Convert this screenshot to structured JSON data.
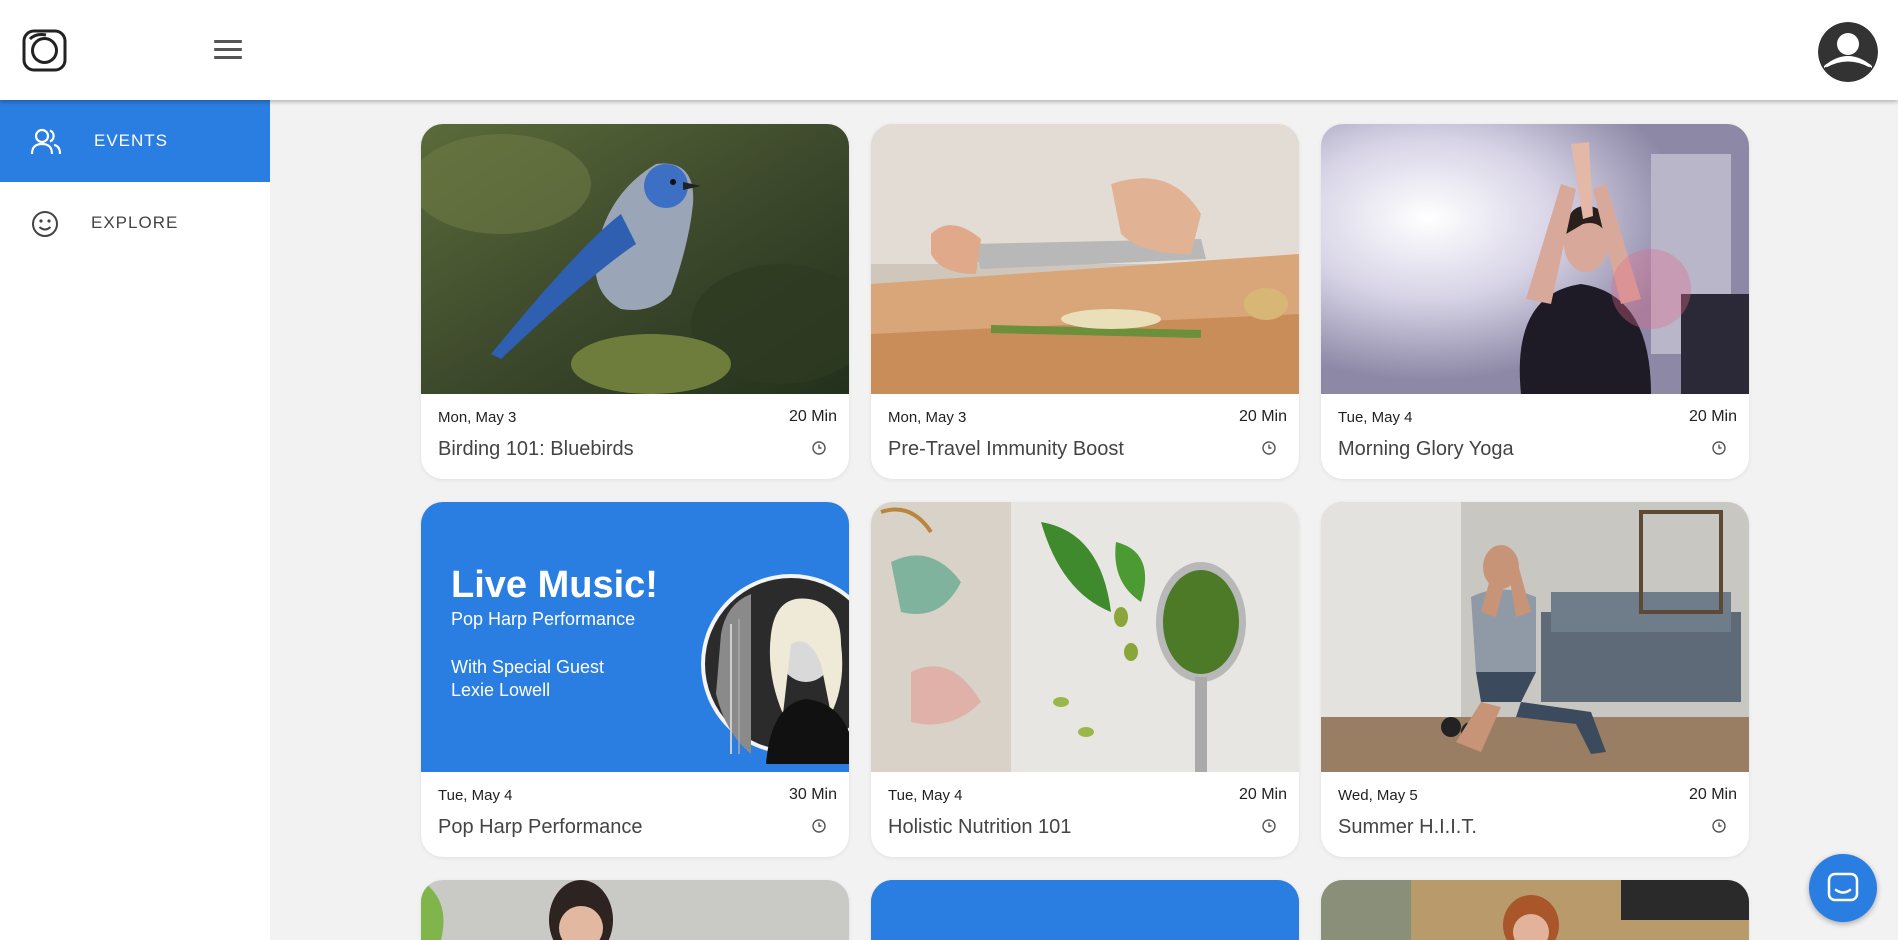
{
  "header": {
    "logo_icon": "camera-ring-logo-icon",
    "menu_icon": "hamburger-menu-icon",
    "avatar_icon": "user-avatar-icon"
  },
  "sidebar": {
    "items": [
      {
        "label": "EVENTS",
        "icon": "people-icon",
        "active": true
      },
      {
        "label": "EXPLORE",
        "icon": "smiley-icon",
        "active": false
      }
    ]
  },
  "colors": {
    "accent": "#2a7de1",
    "background": "#f2f2f2"
  },
  "events": [
    {
      "date": "Mon, May 3",
      "duration": "20 Min",
      "title": "Birding 101: Bluebirds",
      "image": "blue-jay-bird-photo"
    },
    {
      "date": "Mon, May 3",
      "duration": "20 Min",
      "title": "Pre-Travel Immunity Boost",
      "image": "chopping-vegetables-photo"
    },
    {
      "date": "Tue, May 4",
      "duration": "20 Min",
      "title": "Morning Glory Yoga",
      "image": "woman-yoga-photo"
    },
    {
      "date": "Tue, May 4",
      "duration": "30 Min",
      "title": "Pop Harp Performance",
      "image": "live-music-promo",
      "promo": {
        "heading": "Live Music!",
        "subheading": "Pop Harp Performance",
        "guest_line1": "With Special Guest",
        "guest_line2": "Lexie Lowell"
      }
    },
    {
      "date": "Tue, May 4",
      "duration": "20 Min",
      "title": "Holistic Nutrition 101",
      "image": "pesto-spoon-photo"
    },
    {
      "date": "Wed, May 5",
      "duration": "20 Min",
      "title": "Summer H.I.I.T.",
      "image": "man-lunge-workout-photo"
    }
  ],
  "chat": {
    "icon": "chat-bubble-icon"
  }
}
